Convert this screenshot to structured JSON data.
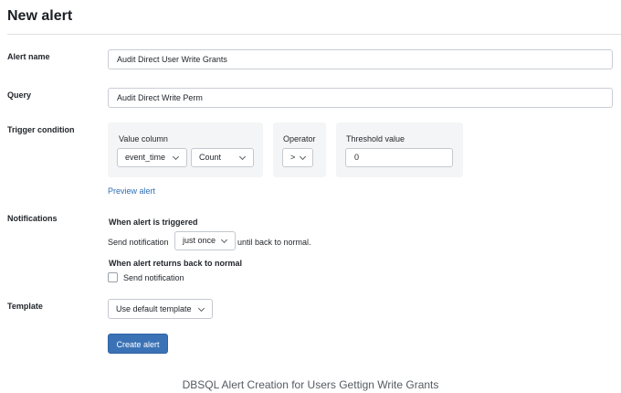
{
  "page": {
    "title": "New alert"
  },
  "alert_name": {
    "label": "Alert name",
    "value": "Audit Direct User Write Grants"
  },
  "query": {
    "label": "Query",
    "value": "Audit Direct Write Perm"
  },
  "trigger": {
    "label": "Trigger condition",
    "value_column": {
      "label": "Value column",
      "column": "event_time",
      "aggregation": "Count"
    },
    "operator": {
      "label": "Operator",
      "value": ">"
    },
    "threshold": {
      "label": "Threshold value",
      "value": "0"
    },
    "preview_link": "Preview alert"
  },
  "notifications": {
    "label": "Notifications",
    "triggered_heading": "When alert is triggered",
    "send_prefix": "Send notification",
    "frequency": "just once",
    "send_suffix": "until back to normal.",
    "normal_heading": "When alert returns back to normal",
    "send_checkbox_label": "Send notification",
    "send_checked": false
  },
  "template": {
    "label": "Template",
    "value": "Use default template"
  },
  "actions": {
    "create_label": "Create alert"
  },
  "caption": "DBSQL Alert Creation for Users Gettign Write Grants"
}
